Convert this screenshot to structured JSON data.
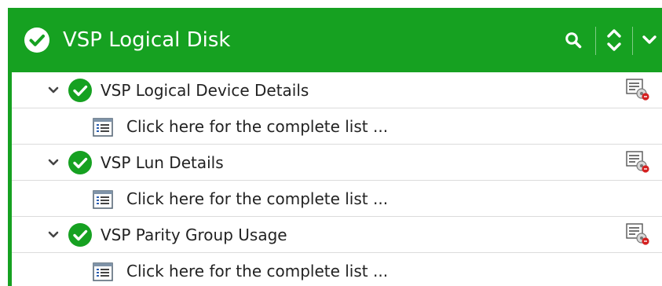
{
  "header": {
    "title": "VSP Logical Disk",
    "status_icon": "check-circle-icon",
    "actions": [
      "search-icon",
      "expand-collapse-icon",
      "chevron-down-icon"
    ],
    "color": "#16a121"
  },
  "groups": [
    {
      "title": "VSP Logical Device Details",
      "status_icon": "check-circle-icon",
      "action_icon": "report-settings-icon",
      "child": {
        "icon": "list-icon",
        "label": "Click here for the complete list ..."
      }
    },
    {
      "title": "VSP Lun Details",
      "status_icon": "check-circle-icon",
      "action_icon": "report-settings-icon",
      "child": {
        "icon": "list-icon",
        "label": "Click here for the complete list ..."
      }
    },
    {
      "title": "VSP Parity Group Usage",
      "status_icon": "check-circle-icon",
      "action_icon": "report-settings-icon",
      "child": {
        "icon": "list-icon",
        "label": "Click here for the complete list ..."
      }
    }
  ],
  "colors": {
    "ok_green": "#16a121",
    "text": "#222222",
    "divider": "#dcdcdc"
  }
}
